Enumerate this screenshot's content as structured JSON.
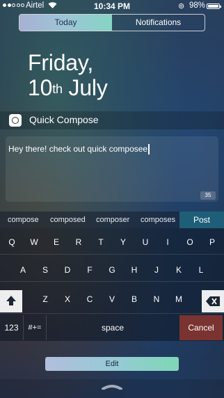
{
  "status_bar": {
    "carrier": "Airtel",
    "time": "10:34 PM",
    "battery_pct": "98%",
    "battery_level": 0.98,
    "signal_bars": [
      true,
      true,
      false,
      false,
      false
    ]
  },
  "segmented": {
    "today": "Today",
    "notifications": "Notifications",
    "selected": "Today"
  },
  "date": {
    "weekday": "Friday,",
    "day": "10",
    "suffix": "th",
    "month": "July"
  },
  "widget": {
    "title": "Quick Compose",
    "text": "Hey there! check out quick composee",
    "char_count": "35"
  },
  "suggestions": [
    "compose",
    "composed",
    "composer",
    "composes"
  ],
  "post_label": "Post",
  "keyboard": {
    "row1": [
      "Q",
      "W",
      "E",
      "R",
      "T",
      "Y",
      "U",
      "I",
      "O",
      "P"
    ],
    "row2": [
      "A",
      "S",
      "D",
      "F",
      "G",
      "H",
      "J",
      "K",
      "L"
    ],
    "row3": [
      "Z",
      "X",
      "C",
      "V",
      "B",
      "N",
      "M"
    ],
    "numbers": "123",
    "symbols": "#+=",
    "space": "space",
    "cancel": "Cancel"
  },
  "edit_label": "Edit",
  "colors": {
    "post": "#1f5e78",
    "cancel": "#7a3330"
  }
}
